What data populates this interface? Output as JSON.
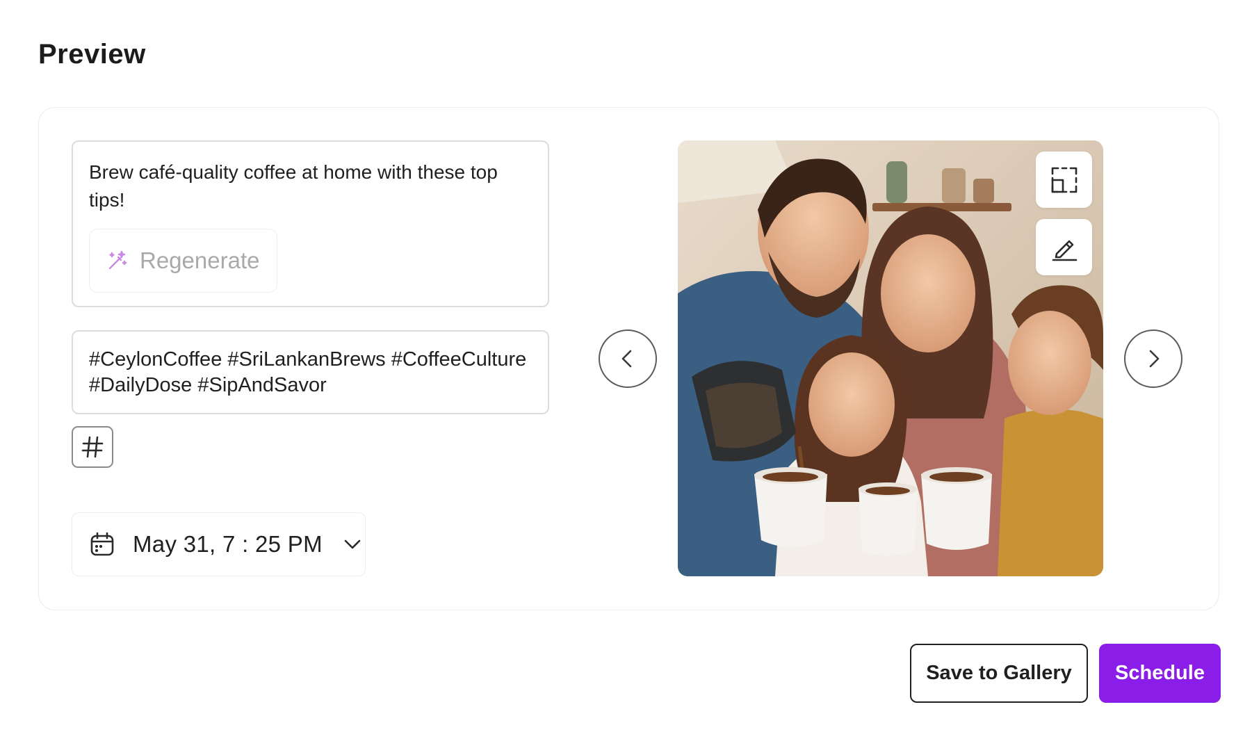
{
  "page": {
    "title": "Preview"
  },
  "post": {
    "caption": "Brew café-quality coffee at home with these top tips!",
    "regenerate_label": "Regenerate",
    "hashtags": "#CeylonCoffee #SriLankanBrews #CoffeeCulture #DailyDose #SipAndSavor"
  },
  "schedule": {
    "datetime": "May 31, 7 : 25 PM"
  },
  "icons": {
    "regenerate": "magic-wand-icon",
    "hashtag": "hashtag-icon",
    "calendar": "calendar-icon",
    "dropdown": "chevron-down-icon",
    "prev": "chevron-left-icon",
    "next": "chevron-right-icon",
    "crop": "crop-icon",
    "edit": "pencil-icon"
  },
  "actions": {
    "save_label": "Save to Gallery",
    "schedule_label": "Schedule"
  },
  "colors": {
    "accent": "#8a1ee8",
    "regenerate_icon": "#c98ae6",
    "muted_text": "#a9a9a9"
  }
}
